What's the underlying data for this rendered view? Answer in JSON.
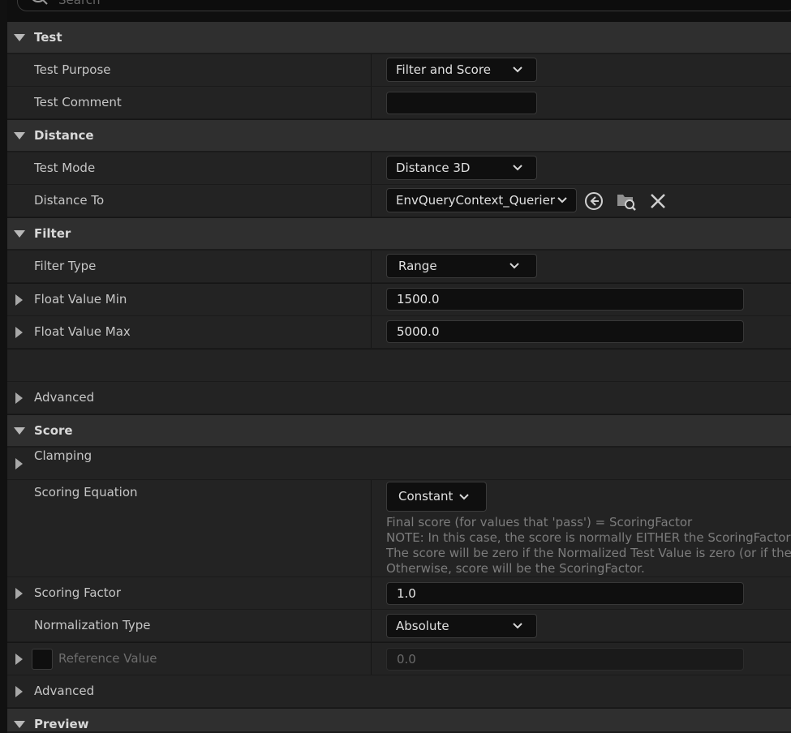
{
  "search": {
    "placeholder": "Search"
  },
  "sections": {
    "test": {
      "title": "Test",
      "purpose_label": "Test Purpose",
      "purpose_value": "Filter and Score",
      "comment_label": "Test Comment",
      "comment_value": ""
    },
    "distance": {
      "title": "Distance",
      "mode_label": "Test Mode",
      "mode_value": "Distance 3D",
      "to_label": "Distance To",
      "to_value": "EnvQueryContext_Querier"
    },
    "filter": {
      "title": "Filter",
      "type_label": "Filter Type",
      "type_value": "Range",
      "min_label": "Float Value Min",
      "min_value": "1500.0",
      "max_label": "Float Value Max",
      "max_value": "5000.0",
      "advanced_label": "Advanced"
    },
    "score": {
      "title": "Score",
      "clamping_label": "Clamping",
      "equation_label": "Scoring Equation",
      "equation_value": "Constant",
      "equation_desc": [
        "Final score (for values that 'pass') = ScoringFactor",
        "NOTE: In this case, the score is normally EITHER the ScoringFactor val",
        "The score will be zero if the Normalized Test Value is zero (or if the test",
        "Otherwise, score will be the ScoringFactor."
      ],
      "factor_label": "Scoring Factor",
      "factor_value": "1.0",
      "normalization_label": "Normalization Type",
      "normalization_value": "Absolute",
      "reference_label": "Reference Value",
      "reference_value": "0.0",
      "reference_enabled": false,
      "advanced_label": "Advanced"
    },
    "preview": {
      "title": "Preview"
    }
  },
  "icons": {
    "use_selected": "arrow-left-circle-icon",
    "browse": "folder-search-icon",
    "clear": "close-icon"
  }
}
